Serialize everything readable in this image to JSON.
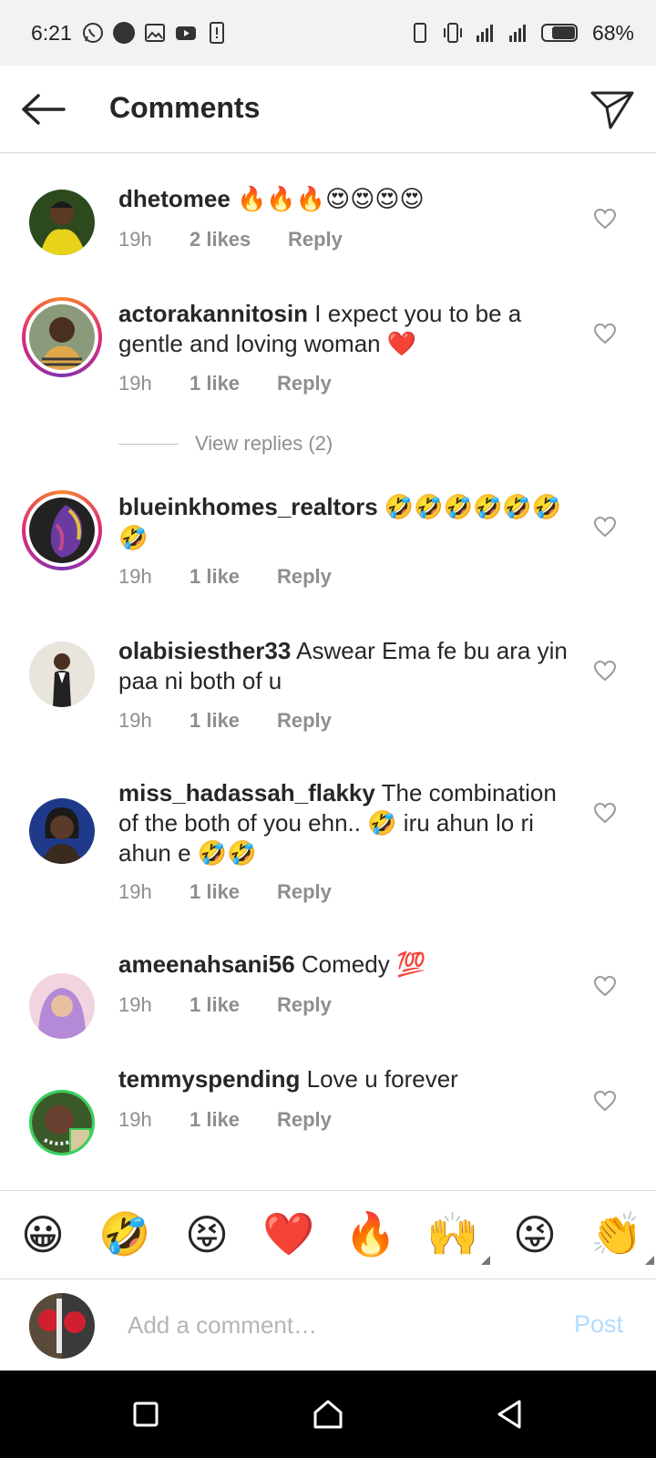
{
  "status_bar": {
    "time": "6:21",
    "battery": "68%"
  },
  "header": {
    "title": "Comments"
  },
  "comments": [
    {
      "username": "dhetomee",
      "text": "🔥🔥🔥😍😍😍😍",
      "time": "19h",
      "likes": "2 likes",
      "reply": "Reply",
      "avatar_colors": [
        "#2d4a1e",
        "#e8d21a"
      ]
    },
    {
      "username": "actorakannitosin",
      "text": "I expect you to be a gentle and loving woman ❤️",
      "time": "19h",
      "likes": "1 like",
      "reply": "Reply",
      "avatar_colors": [
        "#8a9a7a",
        "#e0a84a"
      ],
      "view_replies": "View replies (2)"
    },
    {
      "username": "blueinkhomes_realtors",
      "text": "🤣🤣🤣🤣🤣🤣🤣",
      "time": "19h",
      "likes": "1 like",
      "reply": "Reply",
      "avatar_colors": [
        "#222222",
        "#c24a8a"
      ]
    },
    {
      "username": "olabisiesther33",
      "text": "Aswear Ema fe bu ara yin paa ni both of u",
      "time": "19h",
      "likes": "1 like",
      "reply": "Reply",
      "avatar_colors": [
        "#e9e4dc",
        "#222222"
      ]
    },
    {
      "username": "miss_hadassah_flakky",
      "text": "The combination of the both of you ehn.. 🤣 iru ahun lo ri ahun e 🤣🤣",
      "time": "19h",
      "likes": "1 like",
      "reply": "Reply",
      "avatar_colors": [
        "#1f3a8a",
        "#5a3a2a"
      ]
    },
    {
      "username": "ameenahsani56",
      "text": "Comedy 💯",
      "time": "19h",
      "likes": "1 like",
      "reply": "Reply",
      "avatar_colors": [
        "#f1d4e0",
        "#b48ad8"
      ]
    },
    {
      "username": "temmyspending",
      "text": "Love u forever",
      "time": "19h",
      "likes": "1 like",
      "reply": "Reply",
      "avatar_colors": [
        "#3a5a2a",
        "#d9c9a0"
      ]
    }
  ],
  "emoji_bar": [
    "😀",
    "🤣",
    "😝",
    "❤️",
    "🔥",
    "🙌",
    "😜",
    "👏"
  ],
  "comment_input": {
    "placeholder": "Add a comment…",
    "post_label": "Post"
  },
  "colors": {
    "accent_post": "#b3dbff",
    "heart_red": "#ed4956",
    "meta_gray": "#8e8e8e"
  }
}
